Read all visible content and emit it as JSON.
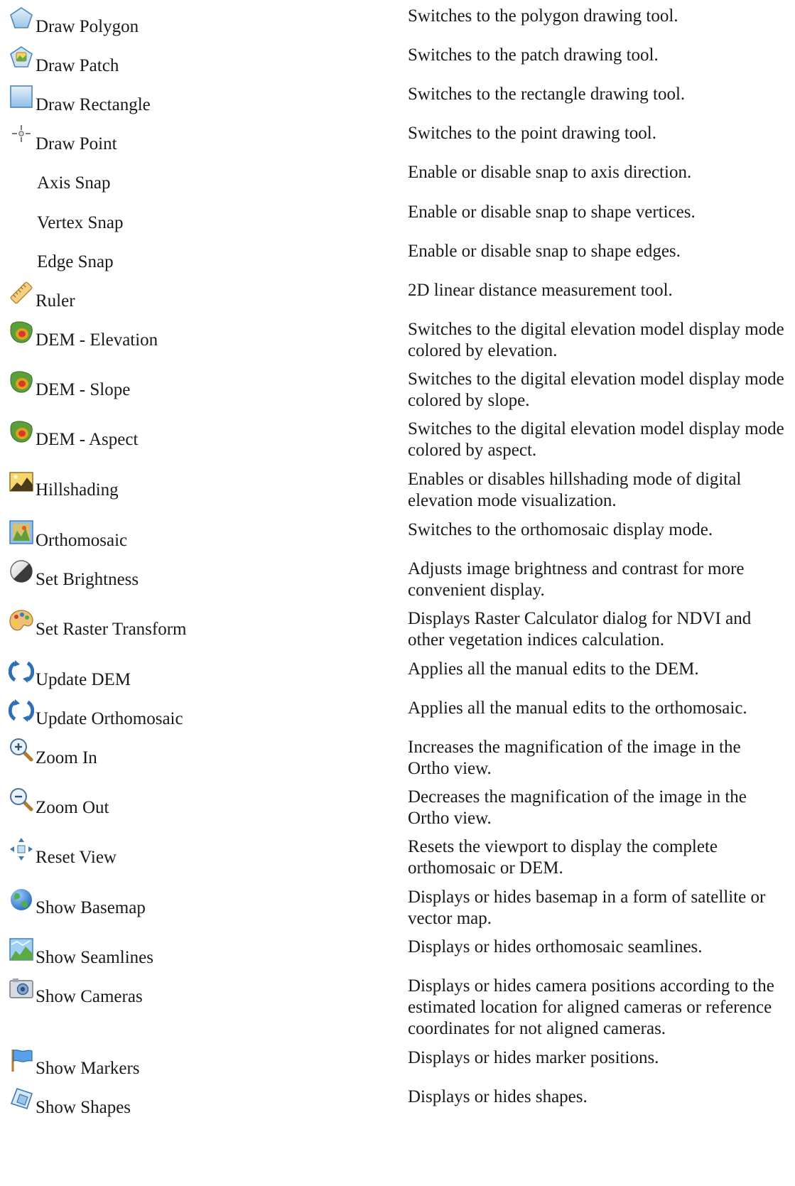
{
  "rows": [
    {
      "icon": "polygon-icon",
      "label": "Draw Polygon",
      "desc": "Switches to the polygon drawing tool."
    },
    {
      "icon": "patch-icon",
      "label": "Draw Patch",
      "desc": "Switches to the patch drawing tool."
    },
    {
      "icon": "rectangle-icon",
      "label": "Draw Rectangle",
      "desc": "Switches to the rectangle drawing tool."
    },
    {
      "icon": "point-icon",
      "label": "Draw Point",
      "desc": "Switches to the point drawing tool."
    },
    {
      "icon": "",
      "label": "Axis Snap",
      "desc": "Enable or disable snap to axis direction."
    },
    {
      "icon": "",
      "label": "Vertex Snap",
      "desc": "Enable or disable snap to shape vertices."
    },
    {
      "icon": "",
      "label": "Edge Snap",
      "desc": "Enable or disable snap to shape edges."
    },
    {
      "icon": "ruler-icon",
      "label": "Ruler",
      "desc": "2D linear distance measurement tool."
    },
    {
      "icon": "dem-icon",
      "label": "DEM - Elevation",
      "desc": "Switches to the digital elevation model display mode colored by elevation."
    },
    {
      "icon": "dem-icon",
      "label": "DEM - Slope",
      "desc": "Switches to the digital elevation model display mode colored by slope."
    },
    {
      "icon": "dem-icon",
      "label": "DEM - Aspect",
      "desc": "Switches to the digital elevation model display mode colored by aspect."
    },
    {
      "icon": "hillshading-icon",
      "label": "Hillshading",
      "desc": "Enables or disables hillshading mode of digital elevation mode visualization."
    },
    {
      "icon": "orthomosaic-icon",
      "label": "Orthomosaic",
      "desc": "Switches to the orthomosaic display mode."
    },
    {
      "icon": "brightness-icon",
      "label": "Set Brightness",
      "desc": "Adjusts image brightness and contrast for more convenient display."
    },
    {
      "icon": "palette-icon",
      "label": "Set Raster Transform",
      "desc": "Displays Raster Calculator dialog for NDVI and other vegetation indices calculation."
    },
    {
      "icon": "update-icon",
      "label": "Update DEM",
      "desc": "Applies all the manual edits to the DEM."
    },
    {
      "icon": "update-icon",
      "label": "Update Orthomosaic",
      "desc": "Applies all the manual edits to the orthomosaic."
    },
    {
      "icon": "zoom-in-icon",
      "label": "Zoom In",
      "desc": "Increases the magnification of the image in the Ortho view."
    },
    {
      "icon": "zoom-out-icon",
      "label": "Zoom Out",
      "desc": "Decreases the magnification of the image in the Ortho view."
    },
    {
      "icon": "reset-view-icon",
      "label": "Reset View",
      "desc": "Resets the viewport to display the complete orthomosaic or DEM."
    },
    {
      "icon": "globe-icon",
      "label": "Show Basemap",
      "desc": "Displays or hides basemap in a form of satellite or vector map."
    },
    {
      "icon": "seamlines-icon",
      "label": "Show Seamlines",
      "desc": "Displays or hides orthomosaic seamlines."
    },
    {
      "icon": "camera-icon",
      "label": "Show Cameras",
      "desc": "Displays or hides camera positions according to the estimated location for aligned cameras or reference coordinates for not aligned cameras."
    },
    {
      "icon": "flag-icon",
      "label": "Show Markers",
      "desc": "Displays or hides marker positions."
    },
    {
      "icon": "shapes-icon",
      "label": "Show Shapes",
      "desc": "Displays or hides shapes."
    }
  ]
}
